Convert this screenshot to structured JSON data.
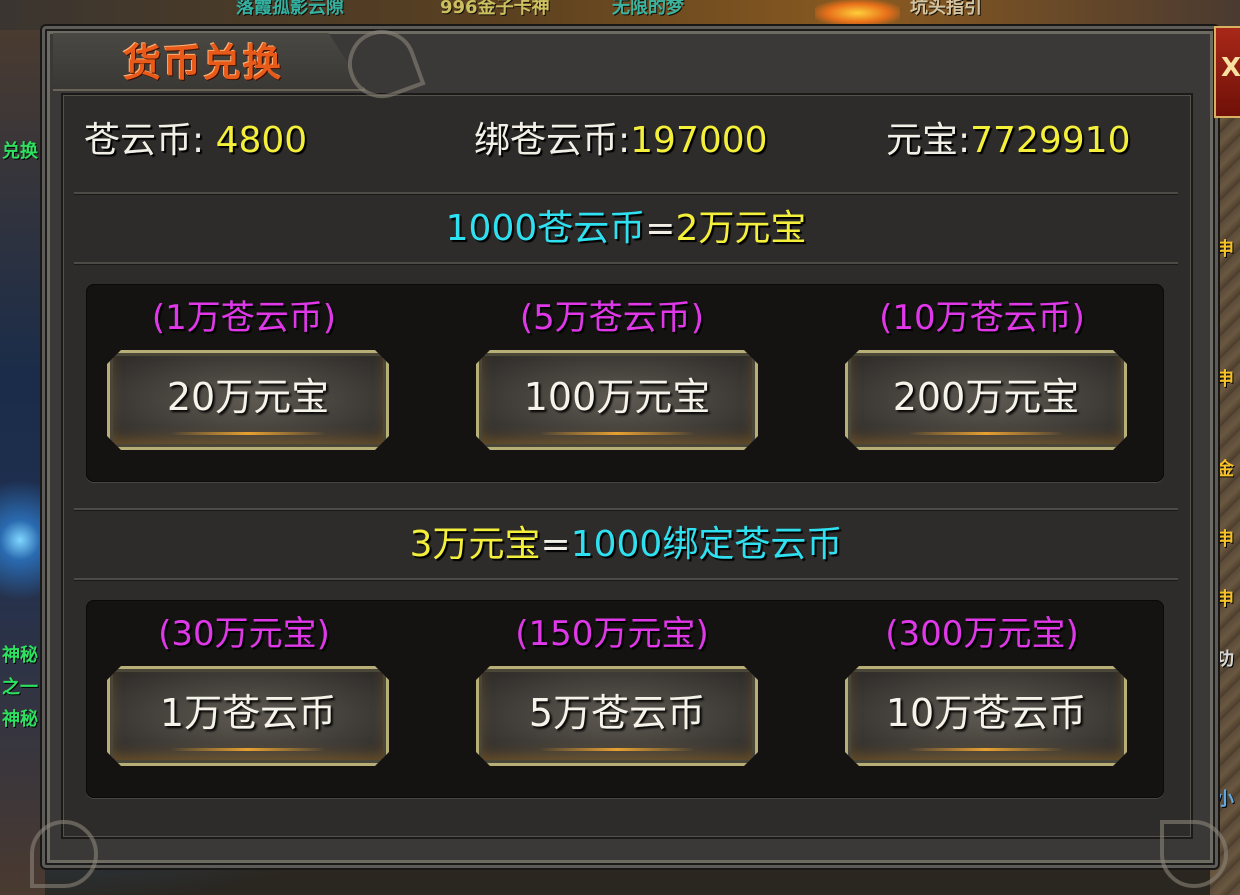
{
  "background": {
    "top_texts": [
      "落霞孤影云隙",
      "996金子卡神",
      "无限的梦",
      "坑头指引"
    ],
    "left_labels": [
      "兑换",
      "神秘",
      "之一",
      "神秘"
    ],
    "right_labels": [
      "申",
      "申",
      "金",
      "申",
      "申",
      "功",
      "小"
    ]
  },
  "panel": {
    "title": "货币兑换",
    "close_label": "X"
  },
  "balances": {
    "cangyun_label": "苍云币: ",
    "cangyun_value": "4800",
    "bound_label": "绑苍云币:",
    "bound_value": "197000",
    "yuanbao_label": "元宝:",
    "yuanbao_value": "7729910"
  },
  "section1": {
    "rate_left": "1000苍云币",
    "rate_eq": "=",
    "rate_right": "2万元宝",
    "options": [
      {
        "cost": "(1万苍云币)",
        "button": "20万元宝"
      },
      {
        "cost": "(5万苍云币)",
        "button": "100万元宝"
      },
      {
        "cost": "(10万苍云币)",
        "button": "200万元宝"
      }
    ]
  },
  "section2": {
    "rate_left": "3万元宝",
    "rate_eq": "=",
    "rate_right": "1000绑定苍云币",
    "options": [
      {
        "cost": "(30万元宝)",
        "button": "1万苍云币"
      },
      {
        "cost": "(150万元宝)",
        "button": "5万苍云币"
      },
      {
        "cost": "(300万元宝)",
        "button": "10万苍云币"
      }
    ]
  },
  "colors": {
    "title": "#e85a1a",
    "value_yellow": "#f4ef3a",
    "rate_cyan": "#2fe0f0",
    "cost_magenta": "#e038e8",
    "button_border": "#b8ae78"
  }
}
